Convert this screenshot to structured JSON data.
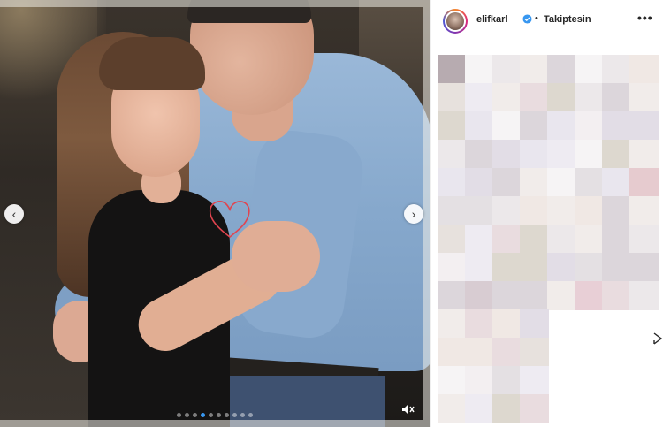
{
  "post": {
    "username": "elifkarl",
    "separator": "•",
    "follow_state": "Takiptesin",
    "more_label": "•••",
    "verified": true
  },
  "carousel": {
    "prev_label": "‹",
    "next_label": "›",
    "slide_count": 10,
    "active_index": 3
  },
  "icons": {
    "heart": "heart-outline-icon",
    "mute": "muted-speaker-icon",
    "verified": "verified-badge-icon",
    "share": "share-icon"
  },
  "colors": {
    "verified_blue": "#3897f0",
    "heart_red": "#e0444f",
    "text_dark": "#262626"
  }
}
